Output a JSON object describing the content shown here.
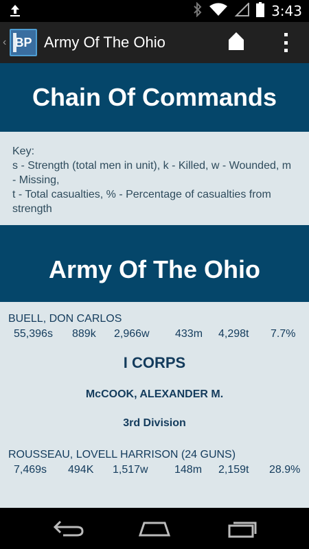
{
  "status": {
    "time": "3:43"
  },
  "action_bar": {
    "logo_text": "BP",
    "title": "Army Of The Ohio"
  },
  "header_banner": "Chain Of Commands",
  "key": {
    "heading": "Key:",
    "line1": "s - Strength (total men in unit), k - Killed, w - Wounded, m - Missing,",
    "line2": "t - Total casualties, % - Percentage of casualties from strength"
  },
  "army_banner": "Army Of The Ohio",
  "army_commander": {
    "name": "BUELL, DON CARLOS",
    "stats": [
      "55,396s",
      "889k",
      "2,966w",
      "433m",
      "4,298t",
      "7.7%"
    ]
  },
  "corps": {
    "title": "I CORPS",
    "commander": "McCOOK, ALEXANDER M.",
    "division": "3rd Division"
  },
  "division_commander": {
    "name": "ROUSSEAU, LOVELL HARRISON (24 GUNS)",
    "stats": [
      "7,469s",
      "494K",
      "1,517w",
      "148m",
      "2,159t",
      "28.9%"
    ]
  }
}
